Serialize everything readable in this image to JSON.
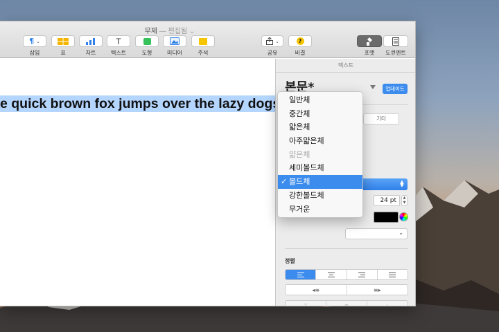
{
  "window": {
    "title": "무제",
    "title_sep": " — ",
    "title_status": "편집됨"
  },
  "toolbar": {
    "left_buttons": [
      {
        "label": "삽입",
        "icon": "paragraph-icon"
      },
      {
        "label": "표",
        "icon": "table-icon"
      },
      {
        "label": "차트",
        "icon": "chart-icon"
      },
      {
        "label": "텍스트",
        "icon": "text-icon"
      },
      {
        "label": "도형",
        "icon": "shape-icon"
      },
      {
        "label": "미디어",
        "icon": "media-icon"
      },
      {
        "label": "주석",
        "icon": "comment-icon"
      }
    ],
    "right_buttons": [
      {
        "label": "공유",
        "icon": "share-icon"
      },
      {
        "label": "비결",
        "icon": "tips-icon"
      },
      {
        "label": "포맷",
        "icon": "format-brush-icon"
      },
      {
        "label": "도큐멘트",
        "icon": "document-icon"
      }
    ]
  },
  "document": {
    "selected_text": "e quick brown fox jumps over the lazy dogs."
  },
  "inspector": {
    "tab_label": "텍스트",
    "style_name": "본문*",
    "update_label": "업데이트",
    "other_label": "기타",
    "font_size": "24 pt",
    "alignment_label": "정렬",
    "text_color": "#000000",
    "accent_color": "#3b8ced"
  },
  "font_menu": {
    "items": [
      {
        "label": "일반체",
        "disabled": false
      },
      {
        "label": "중간체",
        "disabled": false
      },
      {
        "label": "얇은체",
        "disabled": false
      },
      {
        "label": "아주얇은체",
        "disabled": false
      },
      {
        "label": "얇은체",
        "disabled": true
      },
      {
        "label": "세미볼드체",
        "disabled": false
      },
      {
        "label": "볼드체",
        "disabled": false,
        "selected": true
      },
      {
        "label": "강한볼드체",
        "disabled": false
      },
      {
        "label": "무거운",
        "disabled": false
      }
    ],
    "check_glyph": "✓"
  }
}
